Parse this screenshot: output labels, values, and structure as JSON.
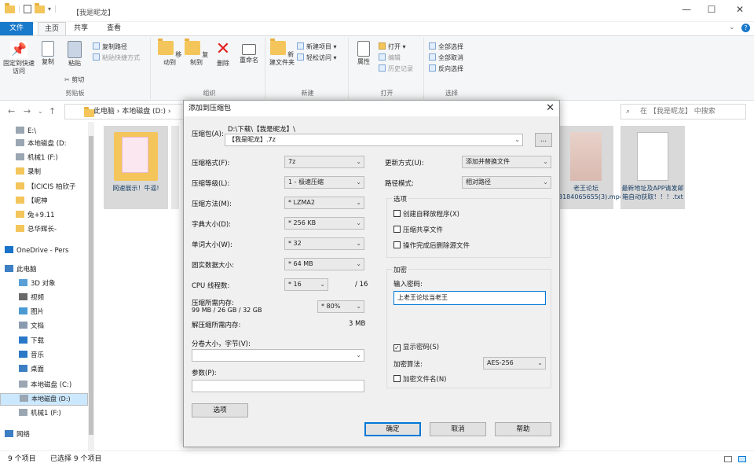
{
  "window": {
    "title": "【我是昵龙】",
    "min": "—",
    "max": "☐",
    "close": "✕"
  },
  "ribbon_tabs": [
    "文件",
    "主页",
    "共享",
    "查看"
  ],
  "ribbon": {
    "clipboard": {
      "pin": "固定到快速访问",
      "copy": "复制",
      "paste": "粘贴",
      "copy_path": "复制路径",
      "paste_shortcut": "粘贴快捷方式",
      "cut": "剪切",
      "label": "剪贴板"
    },
    "organize": {
      "move": "移动到",
      "copyto": "复制到",
      "delete": "删除",
      "rename": "重命名",
      "label": "组织"
    },
    "new": {
      "folder": "新建文件夹",
      "item": "新建项目 ▾",
      "easy": "轻松访问 ▾",
      "label": "新建"
    },
    "open": {
      "props": "属性",
      "open": "打开 ▾",
      "edit": "编辑",
      "history": "历史记录",
      "label": "打开"
    },
    "select": {
      "all": "全部选择",
      "none": "全部取消",
      "invert": "反向选择",
      "label": "选择"
    }
  },
  "address": {
    "path": "此电脑  ›  本地磁盘 (D:)  ›",
    "search_placeholder": "在 【我是昵龙】 中搜索"
  },
  "nav": [
    {
      "label": "E:\\",
      "icon": "drive-icon"
    },
    {
      "label": "本地磁盘 (D:",
      "icon": "drive-icon"
    },
    {
      "label": "机械1 (F:)",
      "icon": "drive-icon"
    },
    {
      "label": "录制",
      "icon": "folder-icon"
    },
    {
      "label": "【ICICIS 柏欣子",
      "icon": "folder-icon"
    },
    {
      "label": "【昵神",
      "icon": "folder-icon"
    },
    {
      "label": "兔+9.11",
      "icon": "folder-icon"
    },
    {
      "label": "总华辉长-",
      "icon": "folder-icon"
    },
    {
      "label": "OneDrive - Pers",
      "icon": "cloud-icon"
    },
    {
      "label": "此电脑",
      "icon": "pc-icon"
    },
    {
      "label": "3D 对象",
      "icon": "cube-icon"
    },
    {
      "label": "视频",
      "icon": "video-icon"
    },
    {
      "label": "图片",
      "icon": "picture-icon"
    },
    {
      "label": "文档",
      "icon": "document-icon"
    },
    {
      "label": "下载",
      "icon": "download-icon"
    },
    {
      "label": "音乐",
      "icon": "music-icon"
    },
    {
      "label": "桌面",
      "icon": "desktop-icon"
    },
    {
      "label": "本地磁盘 (C:)",
      "icon": "drive-icon"
    },
    {
      "label": "本地磁盘 (D:)",
      "icon": "drive-icon"
    },
    {
      "label": "机械1 (F:)",
      "icon": "drive-icon"
    },
    {
      "label": "网络",
      "icon": "network-icon"
    }
  ],
  "files": [
    {
      "name": "网速展示！牛逼!",
      "kind": "folder"
    },
    {
      "name": "老王论坛3184065655(3).mp4",
      "kind": "video"
    },
    {
      "name": "最新地址及APP请发邮箱自动获取！！！.txt",
      "kind": "text"
    }
  ],
  "status": {
    "count": "9 个项目",
    "selected": "已选择 9 个项目"
  },
  "dialog": {
    "title": "添加到压缩包",
    "archive_label": "压缩包(A):",
    "archive_dir": "D:\\下载\\【我是昵龙】\\",
    "archive_name": "【我是昵龙】.7z",
    "browse": "...",
    "format_label": "压缩格式(F):",
    "format": "7z",
    "level_label": "压缩等级(L):",
    "level": "1 - 极速压缩",
    "method_label": "压缩方法(M):",
    "method": "* LZMA2",
    "dict_label": "字典大小(D):",
    "dict": "* 256 KB",
    "word_label": "单词大小(W):",
    "word": "* 32",
    "solid_label": "固实数据大小:",
    "solid": "* 64 MB",
    "cpu_label": "CPU 线程数:",
    "cpu": "* 16",
    "cpu_total": "/ 16",
    "mem_label": "压缩所需内存:",
    "mem_detail": "99 MB / 26 GB / 32 GB",
    "mem_pct": "* 80%",
    "demem_label": "解压缩所需内存:",
    "demem": "3 MB",
    "split_label": "分卷大小，字节(V):",
    "split": "",
    "params_label": "参数(P):",
    "params": "",
    "options_btn": "选项",
    "update_label": "更新方式(U):",
    "update": "添加并替换文件",
    "path_label": "路径模式:",
    "path": "相对路径",
    "opts_legend": "选项",
    "opt_sfx": "创建自释放程序(X)",
    "opt_shared": "压缩共享文件",
    "opt_delete": "操作完成后删除源文件",
    "enc_legend": "加密",
    "pwd_label": "输入密码:",
    "pwd": "上老王论坛当老王",
    "show_pwd": "显示密码(S)",
    "enc_method_label": "加密算法:",
    "enc_method": "AES-256",
    "enc_names": "加密文件名(N)",
    "ok": "确定",
    "cancel": "取消",
    "help": "帮助"
  }
}
